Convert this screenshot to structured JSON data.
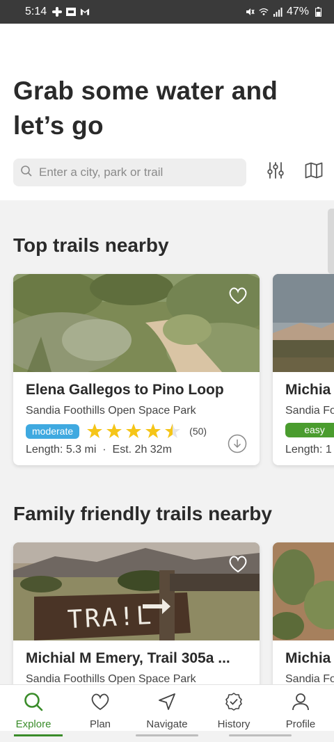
{
  "status_bar": {
    "time": "5:14",
    "battery": "47%",
    "icons_left": [
      "slack-icon",
      "nt-icon",
      "gmail-icon"
    ],
    "icons_right": [
      "mute-icon",
      "wifi-icon",
      "signal-icon",
      "battery-icon"
    ]
  },
  "header": {
    "title": "Grab some water and let’s go",
    "search_placeholder": "Enter a city, park or trail"
  },
  "sections": [
    {
      "title": "Top trails nearby",
      "cards": [
        {
          "name": "Elena Gallegos to Pino Loop",
          "park": "Sandia Foothills Open Space Park",
          "difficulty": "moderate",
          "rating": 4.5,
          "reviews": "(50)",
          "length": "Length: 5.3 mi",
          "est": "Est. 2h 32m"
        },
        {
          "name": "Michia",
          "park": "Sandia Fo",
          "difficulty": "easy",
          "length": "Length: 1"
        }
      ]
    },
    {
      "title": "Family friendly trails nearby",
      "cards": [
        {
          "name": "Michial M Emery, Trail 305a ...",
          "park": "Sandia Foothills Open Space Park",
          "sign_text": "TRA!L"
        },
        {
          "name": "Michia",
          "park": "Sandia Fo"
        }
      ]
    }
  ],
  "nav": {
    "items": [
      {
        "label": "Explore",
        "icon": "search-icon",
        "active": true
      },
      {
        "label": "Plan",
        "icon": "heart-icon"
      },
      {
        "label": "Navigate",
        "icon": "navigate-icon"
      },
      {
        "label": "History",
        "icon": "history-check-icon"
      },
      {
        "label": "Profile",
        "icon": "profile-icon"
      }
    ],
    "active_color": "#3a8c2a"
  },
  "colors": {
    "moderate_badge": "#3fa9e0",
    "easy_badge": "#4a9c2e",
    "star": "#f5c518"
  }
}
